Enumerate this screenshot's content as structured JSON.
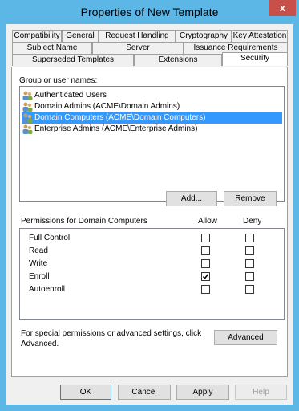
{
  "window": {
    "title": "Properties of New Template",
    "close_glyph": "x"
  },
  "tabs": {
    "row1": [
      "Compatibility",
      "General",
      "Request Handling",
      "Cryptography",
      "Key Attestation"
    ],
    "row2": [
      "Subject Name",
      "Server",
      "Issuance Requirements"
    ],
    "row3": [
      "Superseded Templates",
      "Extensions",
      "Security"
    ],
    "active": "Security"
  },
  "security": {
    "group_label": "Group or user names:",
    "users": [
      {
        "name": "Authenticated Users",
        "selected": false
      },
      {
        "name": "Domain Admins (ACME\\Domain Admins)",
        "selected": false
      },
      {
        "name": "Domain Computers (ACME\\Domain Computers)",
        "selected": true
      },
      {
        "name": "Enterprise Admins (ACME\\Enterprise Admins)",
        "selected": false
      }
    ],
    "add_label": "Add...",
    "remove_label": "Remove",
    "permissions_label": "Permissions for Domain Computers",
    "allow_header": "Allow",
    "deny_header": "Deny",
    "permissions": [
      {
        "name": "Full Control",
        "allow": false,
        "deny": false
      },
      {
        "name": "Read",
        "allow": false,
        "deny": false
      },
      {
        "name": "Write",
        "allow": false,
        "deny": false
      },
      {
        "name": "Enroll",
        "allow": true,
        "deny": false
      },
      {
        "name": "Autoenroll",
        "allow": false,
        "deny": false
      }
    ],
    "special_text_1": "For special permissions or advanced settings, click",
    "special_text_2": "Advanced.",
    "advanced_label": "Advanced"
  },
  "footer": {
    "ok": "OK",
    "cancel": "Cancel",
    "apply": "Apply",
    "help": "Help"
  },
  "colors": {
    "title_bar": "#5cb6e6",
    "selection": "#3399ff",
    "close": "#c7504a"
  }
}
